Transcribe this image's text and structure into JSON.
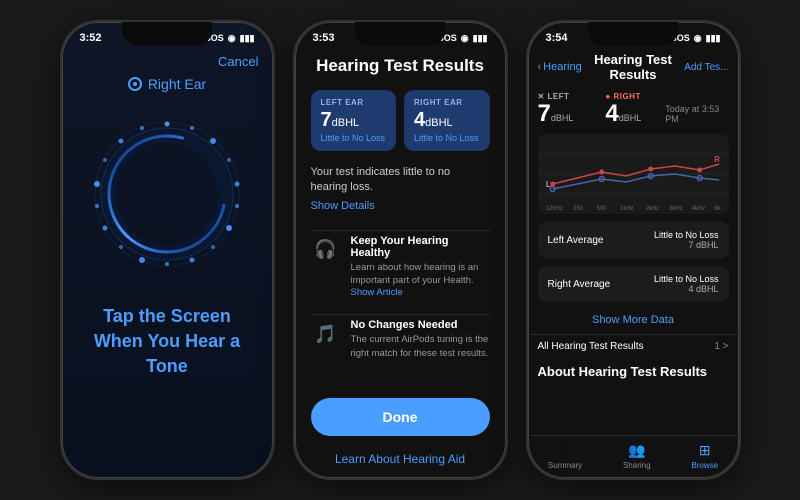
{
  "phone1": {
    "status_time": "3:52",
    "status_icons": "SOS ◉ ▮▮▮",
    "cancel_label": "Cancel",
    "right_ear_label": "Right Ear",
    "tap_text": "Tap the Screen When You\nHear a Tone",
    "accent_color": "#4a9eff"
  },
  "phone2": {
    "status_time": "3:53",
    "status_icons": "SOS ◉ ▮▮▮",
    "title": "Hearing Test Results",
    "left_ear": {
      "label": "LEFT EAR",
      "value": "7",
      "unit": "dBHL",
      "status": "Little to No Loss"
    },
    "right_ear": {
      "label": "RIGHT EAR",
      "value": "4",
      "unit": "dBHL",
      "status": "Little to No Loss"
    },
    "description": "Your test indicates little to no hearing loss.",
    "show_details": "Show Details",
    "info1_title": "Keep Your Hearing Healthy",
    "info1_desc": "Learn about how hearing is an important part of your Health.",
    "info1_link": "Show Article",
    "info2_title": "No Changes Needed",
    "info2_desc": "The current AirPods tuning is the right match for these test results.",
    "done_label": "Done",
    "learn_link": "Learn About Hearing Aid"
  },
  "phone3": {
    "status_time": "3:54",
    "status_icons": "SOS ◉ ▮▮▮",
    "back_label": "Hearing",
    "title": "Hearing Test Results",
    "add_label": "Add Tes...",
    "left_label": "LEFT",
    "left_value": "7",
    "left_unit": "dBHL",
    "right_label": "RIGHT",
    "right_value": "4",
    "right_unit": "dBHL",
    "date": "Today at 3:53 PM",
    "left_avg_label": "Left Average",
    "left_avg_status": "Little to No Loss",
    "left_avg_value": "7 dBHL",
    "right_avg_label": "Right Average",
    "right_avg_status": "Little to No Loss",
    "right_avg_value": "4 dBHL",
    "show_more": "Show More Data",
    "section_label": "All Hearing Test Results",
    "section_count": "1 >",
    "about_title": "About Hearing Test Results",
    "tab_summary": "Summary",
    "tab_sharing": "Sharing",
    "tab_browse": "Browse"
  }
}
